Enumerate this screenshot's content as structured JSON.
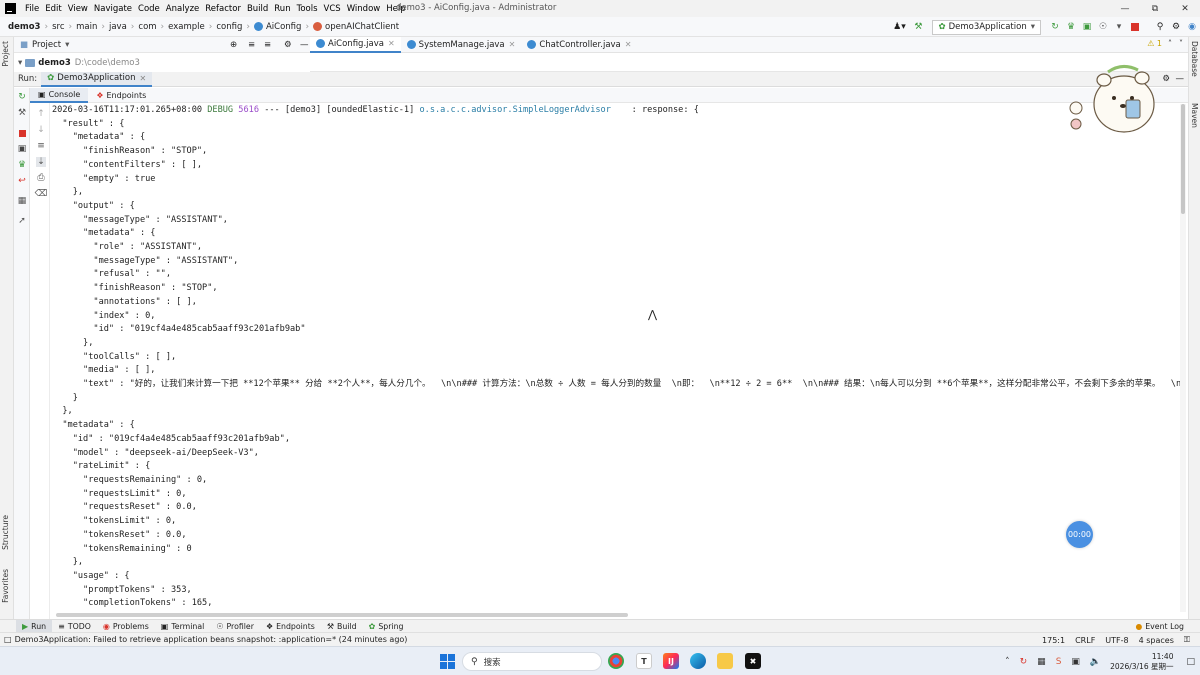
{
  "menubar": {
    "items": [
      "File",
      "Edit",
      "View",
      "Navigate",
      "Code",
      "Analyze",
      "Refactor",
      "Build",
      "Run",
      "Tools",
      "VCS",
      "Window",
      "Help"
    ],
    "window_title": "demo3 - AiConfig.java - Administrator"
  },
  "navbar": {
    "breadcrumbs": [
      "demo3",
      "src",
      "main",
      "java",
      "com",
      "example",
      "config",
      "AiConfig",
      "openAIChatClient"
    ],
    "run_config": "Demo3Application"
  },
  "project": {
    "header": "Project",
    "root_name": "demo3",
    "root_path": "D:\\code\\demo3"
  },
  "editor": {
    "tabs": [
      "AiConfig.java",
      "SystemManage.java",
      "ChatController.java"
    ],
    "warning_count": "1"
  },
  "run": {
    "label": "Run:",
    "tab": "Demo3Application",
    "console_tabs": [
      "Console",
      "Endpoints"
    ]
  },
  "console": {
    "header": {
      "date": "2026-03-16T11:17:01.265+08:00",
      "level": "DEBUG",
      "pid": "5616",
      "sep": "---",
      "app": "[demo3]",
      "thread": "[oundedElastic-1]",
      "logger": "o.s.a.c.c.advisor.SimpleLoggerAdvisor",
      "message": "   : response: {"
    },
    "lines": [
      "  \"result\" : {",
      "    \"metadata\" : {",
      "      \"finishReason\" : \"STOP\",",
      "      \"contentFilters\" : [ ],",
      "      \"empty\" : true",
      "    },",
      "    \"output\" : {",
      "      \"messageType\" : \"ASSISTANT\",",
      "      \"metadata\" : {",
      "        \"role\" : \"ASSISTANT\",",
      "        \"messageType\" : \"ASSISTANT\",",
      "        \"refusal\" : \"\",",
      "        \"finishReason\" : \"STOP\",",
      "        \"annotations\" : [ ],",
      "        \"index\" : 0,",
      "        \"id\" : \"019cf4a4e485cab5aaff93c201afb9ab\"",
      "      },",
      "      \"toolCalls\" : [ ],",
      "      \"media\" : [ ],",
      "      \"text\" : \"好的，让我们来计算一下把 **12个苹果** 分给 **2个人**，每人分几个。  \\n\\n### 计算方法：\\n总数 ÷ 人数 = 每人分到的数量  \\n即：  \\n**12 ÷ 2 = 6**  \\n\\n### 结果：\\n每人可以分到 **6个苹果**，这样分配非常公平，不会剩下多余的苹果。  \\n\\n### 举例验",
      "    }",
      "  },",
      "  \"metadata\" : {",
      "    \"id\" : \"019cf4a4e485cab5aaff93c201afb9ab\",",
      "    \"model\" : \"deepseek-ai/DeepSeek-V3\",",
      "    \"rateLimit\" : {",
      "      \"requestsRemaining\" : 0,",
      "      \"requestsLimit\" : 0,",
      "      \"requestsReset\" : 0.0,",
      "      \"tokensLimit\" : 0,",
      "      \"tokensReset\" : 0.0,",
      "      \"tokensRemaining\" : 0",
      "    },",
      "    \"usage\" : {",
      "      \"promptTokens\" : 353,",
      "      \"completionTokens\" : 165,"
    ]
  },
  "timer_badge": "00:00",
  "bottom_tabs": [
    "Run",
    "TODO",
    "Problems",
    "Terminal",
    "Profiler",
    "Endpoints",
    "Build",
    "Spring"
  ],
  "event_log": "Event Log",
  "statusbar": {
    "message": "Demo3Application: Failed to retrieve application beans snapshot: :application=* (24 minutes ago)",
    "position": "175:1",
    "line_sep": "CRLF",
    "encoding": "UTF-8",
    "indent": "4 spaces"
  },
  "taskbar": {
    "search_placeholder": "搜索",
    "time": "11:40",
    "date": "2026/3/16 星期一"
  },
  "side_tabs": {
    "left_top": "Project",
    "left_structure": "Structure",
    "left_favorites": "Favorites",
    "right_database": "Database",
    "right_maven": "Maven"
  },
  "colors": {
    "accent": "#4083c9",
    "run_green": "#3d9a3d",
    "stop_red": "#d9342b",
    "timer_blue": "#4a90e2"
  }
}
